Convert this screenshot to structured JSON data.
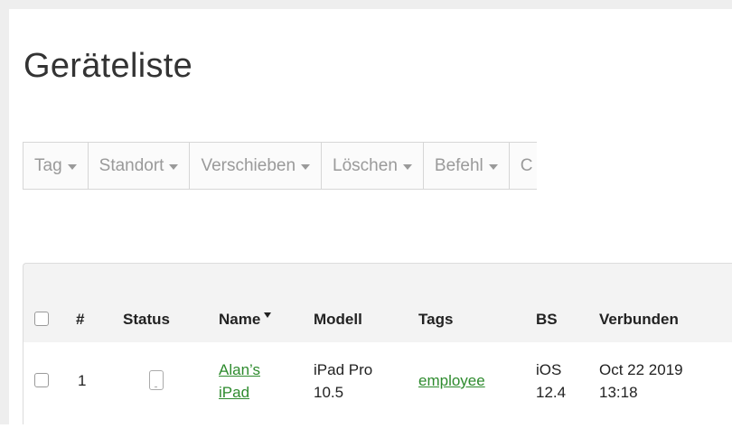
{
  "page": {
    "title": "Geräteliste"
  },
  "toolbar": {
    "items": [
      {
        "label": "Tag"
      },
      {
        "label": "Standort"
      },
      {
        "label": "Verschieben"
      },
      {
        "label": "Löschen"
      },
      {
        "label": "Befehl"
      },
      {
        "label": "C"
      }
    ]
  },
  "table": {
    "headers": {
      "number": "#",
      "status": "Status",
      "name": "Name",
      "model": "Modell",
      "tags": "Tags",
      "os": "BS",
      "connected": "Verbunden"
    },
    "rows": [
      {
        "number": "1",
        "status_icon": "tablet-icon",
        "name_line1": "Alan’s",
        "name_line2": "iPad",
        "model_line1": "iPad Pro",
        "model_line2": "10.5",
        "tags": "employee",
        "os_line1": "iOS",
        "os_line2": "12.4",
        "connected_line1": "Oct 22 2019",
        "connected_line2": "13:18"
      }
    ]
  },
  "colors": {
    "link": "#2e8b2e",
    "toolbar_text": "#9a9a9a",
    "header_bg": "#f3f3f3",
    "frame": "#eeeeee"
  }
}
